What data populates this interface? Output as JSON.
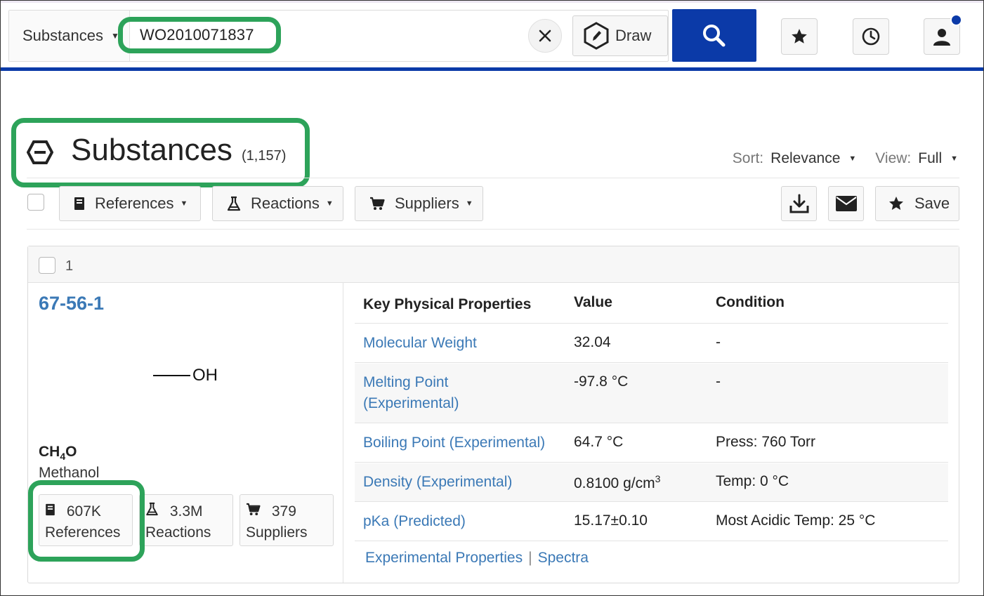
{
  "header": {
    "scope_label": "Substances",
    "query": "WO2010071837",
    "draw_label": "Draw",
    "colors": {
      "brand": "#0b3aa8",
      "highlight": "#2da35a",
      "link": "#3b79b6"
    }
  },
  "results": {
    "title": "Substances",
    "count": "(1,157)",
    "sort_label": "Sort:",
    "sort_value": "Relevance",
    "view_label": "View:",
    "view_value": "Full",
    "toolbar": {
      "references": "References",
      "reactions": "Reactions",
      "suppliers": "Suppliers",
      "save": "Save"
    }
  },
  "substance": {
    "index": "1",
    "cas": "67-56-1",
    "structure_atom": "OH",
    "formula": {
      "c": "CH",
      "sub": "4",
      "rest": "O"
    },
    "name": "Methanol",
    "counts": {
      "references_num": "607K",
      "references_label": "References",
      "reactions_num": "3.3M",
      "reactions_label": "Reactions",
      "suppliers_num": "379",
      "suppliers_label": "Suppliers"
    }
  },
  "properties": {
    "headers": {
      "property": "Key Physical Properties",
      "value": "Value",
      "condition": "Condition"
    },
    "rows": [
      {
        "property": "Molecular Weight",
        "value": "32.04",
        "condition": "-"
      },
      {
        "property": "Melting Point (Experimental)",
        "value": "-97.8 °C",
        "condition": "-"
      },
      {
        "property": "Boiling Point (Experimental)",
        "value": "64.7 °C",
        "condition": "Press: 760 Torr"
      },
      {
        "property": "Density (Experimental)",
        "value": "0.8100 g/cm",
        "value_sup": "3",
        "condition": "Temp: 0 °C"
      },
      {
        "property": "pKa (Predicted)",
        "value": "15.17±0.10",
        "condition": "Most Acidic Temp: 25 °C"
      }
    ],
    "footer": {
      "experimental": "Experimental Properties",
      "divider": "|",
      "spectra": "Spectra"
    }
  }
}
